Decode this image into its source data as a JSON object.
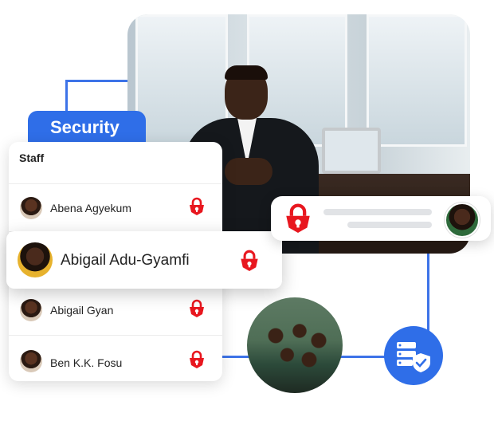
{
  "security_tag": {
    "label": "Security"
  },
  "staff": {
    "heading": "Staff",
    "rows": [
      {
        "name": "Abena Agyekum",
        "lock_icon": "lock-icon"
      },
      {
        "name": "Abigail Adu-Gyamfi",
        "lock_icon": "lock-icon",
        "highlighted": true
      },
      {
        "name": "Abigail Gyan",
        "lock_icon": "lock-icon"
      },
      {
        "name": "Ben K.K. Fosu",
        "lock_icon": "lock-icon"
      }
    ]
  },
  "notification": {
    "lock_icon": "lock-icon",
    "avatar": "avatar"
  },
  "server_badge": {
    "icon": "server-shield-icon"
  },
  "colors": {
    "accent": "#2f6ee8",
    "lock": "#e8171f",
    "card": "#ffffff"
  }
}
